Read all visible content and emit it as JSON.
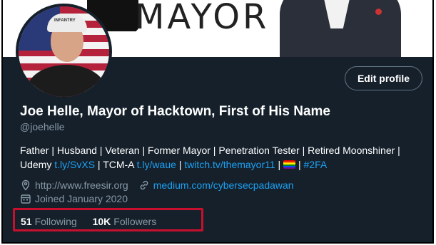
{
  "banner": {
    "text": "MAYOR"
  },
  "avatar": {
    "cap_text": "INFANTRY"
  },
  "profile": {
    "edit_button": "Edit profile",
    "display_name": "Joe Helle, Mayor of Hacktown, First of His Name",
    "handle": "@joehelle",
    "bio_line1": "Father | Husband | Veteran | Former Mayor | Penetration Tester | Retired Moonshiner |",
    "bio_line2_pre": "Udemy ",
    "bio_link1": "t.ly/SvXS",
    "bio_mid1": " | TCM-A ",
    "bio_link2": "t.ly/waue",
    "bio_mid2": " | ",
    "bio_link3": "twitch.tv/themayor11",
    "bio_mid3": " | ",
    "bio_mid4": " | ",
    "bio_link4": "#2FA",
    "location": "http://www.freesir.org",
    "website": "medium.com/cybersecpadawan",
    "joined": "Joined January 2020",
    "following_count": "51",
    "following_label": "Following",
    "followers_count": "10K",
    "followers_label": "Followers"
  },
  "colors": {
    "background": "#15202b",
    "accent": "#1da1f2",
    "muted": "#8899a6",
    "highlight_box": "#c8102e"
  },
  "icons": [
    "location-icon",
    "link-icon",
    "calendar-icon",
    "rainbow-flag-emoji"
  ]
}
